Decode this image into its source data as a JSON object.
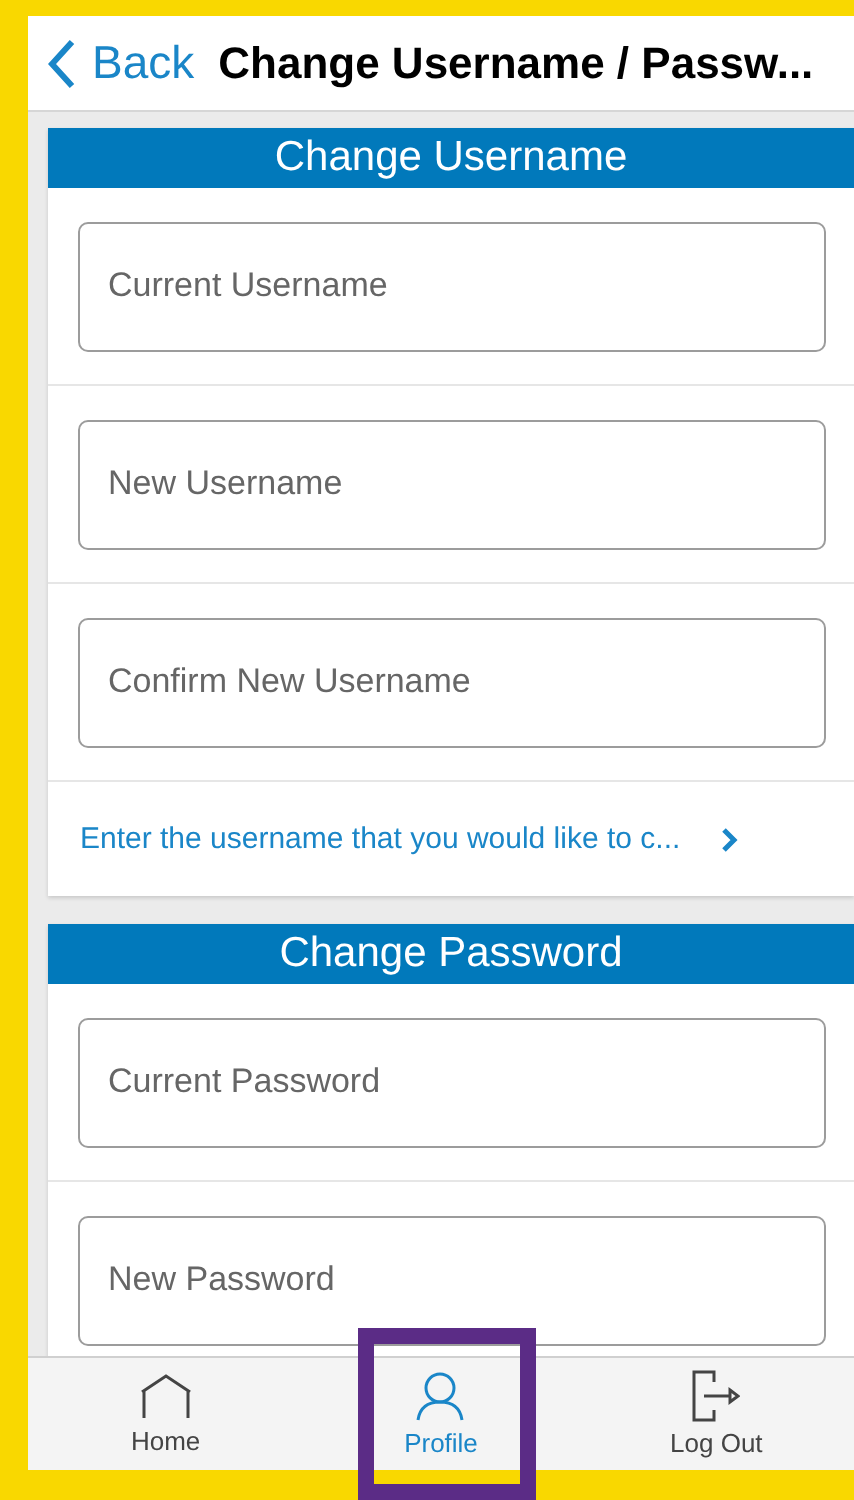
{
  "nav": {
    "back": "Back",
    "title": "Change Username / Passw..."
  },
  "sections": [
    {
      "title": "Change Username",
      "fields": [
        {
          "placeholder": "Current Username"
        },
        {
          "placeholder": "New Username"
        },
        {
          "placeholder": "Confirm New Username"
        }
      ],
      "hint": "Enter the username that you would like to c..."
    },
    {
      "title": "Change Password",
      "fields": [
        {
          "placeholder": "Current Password"
        },
        {
          "placeholder": "New Password"
        }
      ]
    }
  ],
  "tabs": [
    {
      "label": "Home",
      "kind": "home",
      "selected": false,
      "highlighted": false
    },
    {
      "label": "Profile",
      "kind": "profile",
      "selected": true,
      "highlighted": true
    },
    {
      "label": "Log Out",
      "kind": "logout",
      "selected": false,
      "highlighted": false
    }
  ]
}
